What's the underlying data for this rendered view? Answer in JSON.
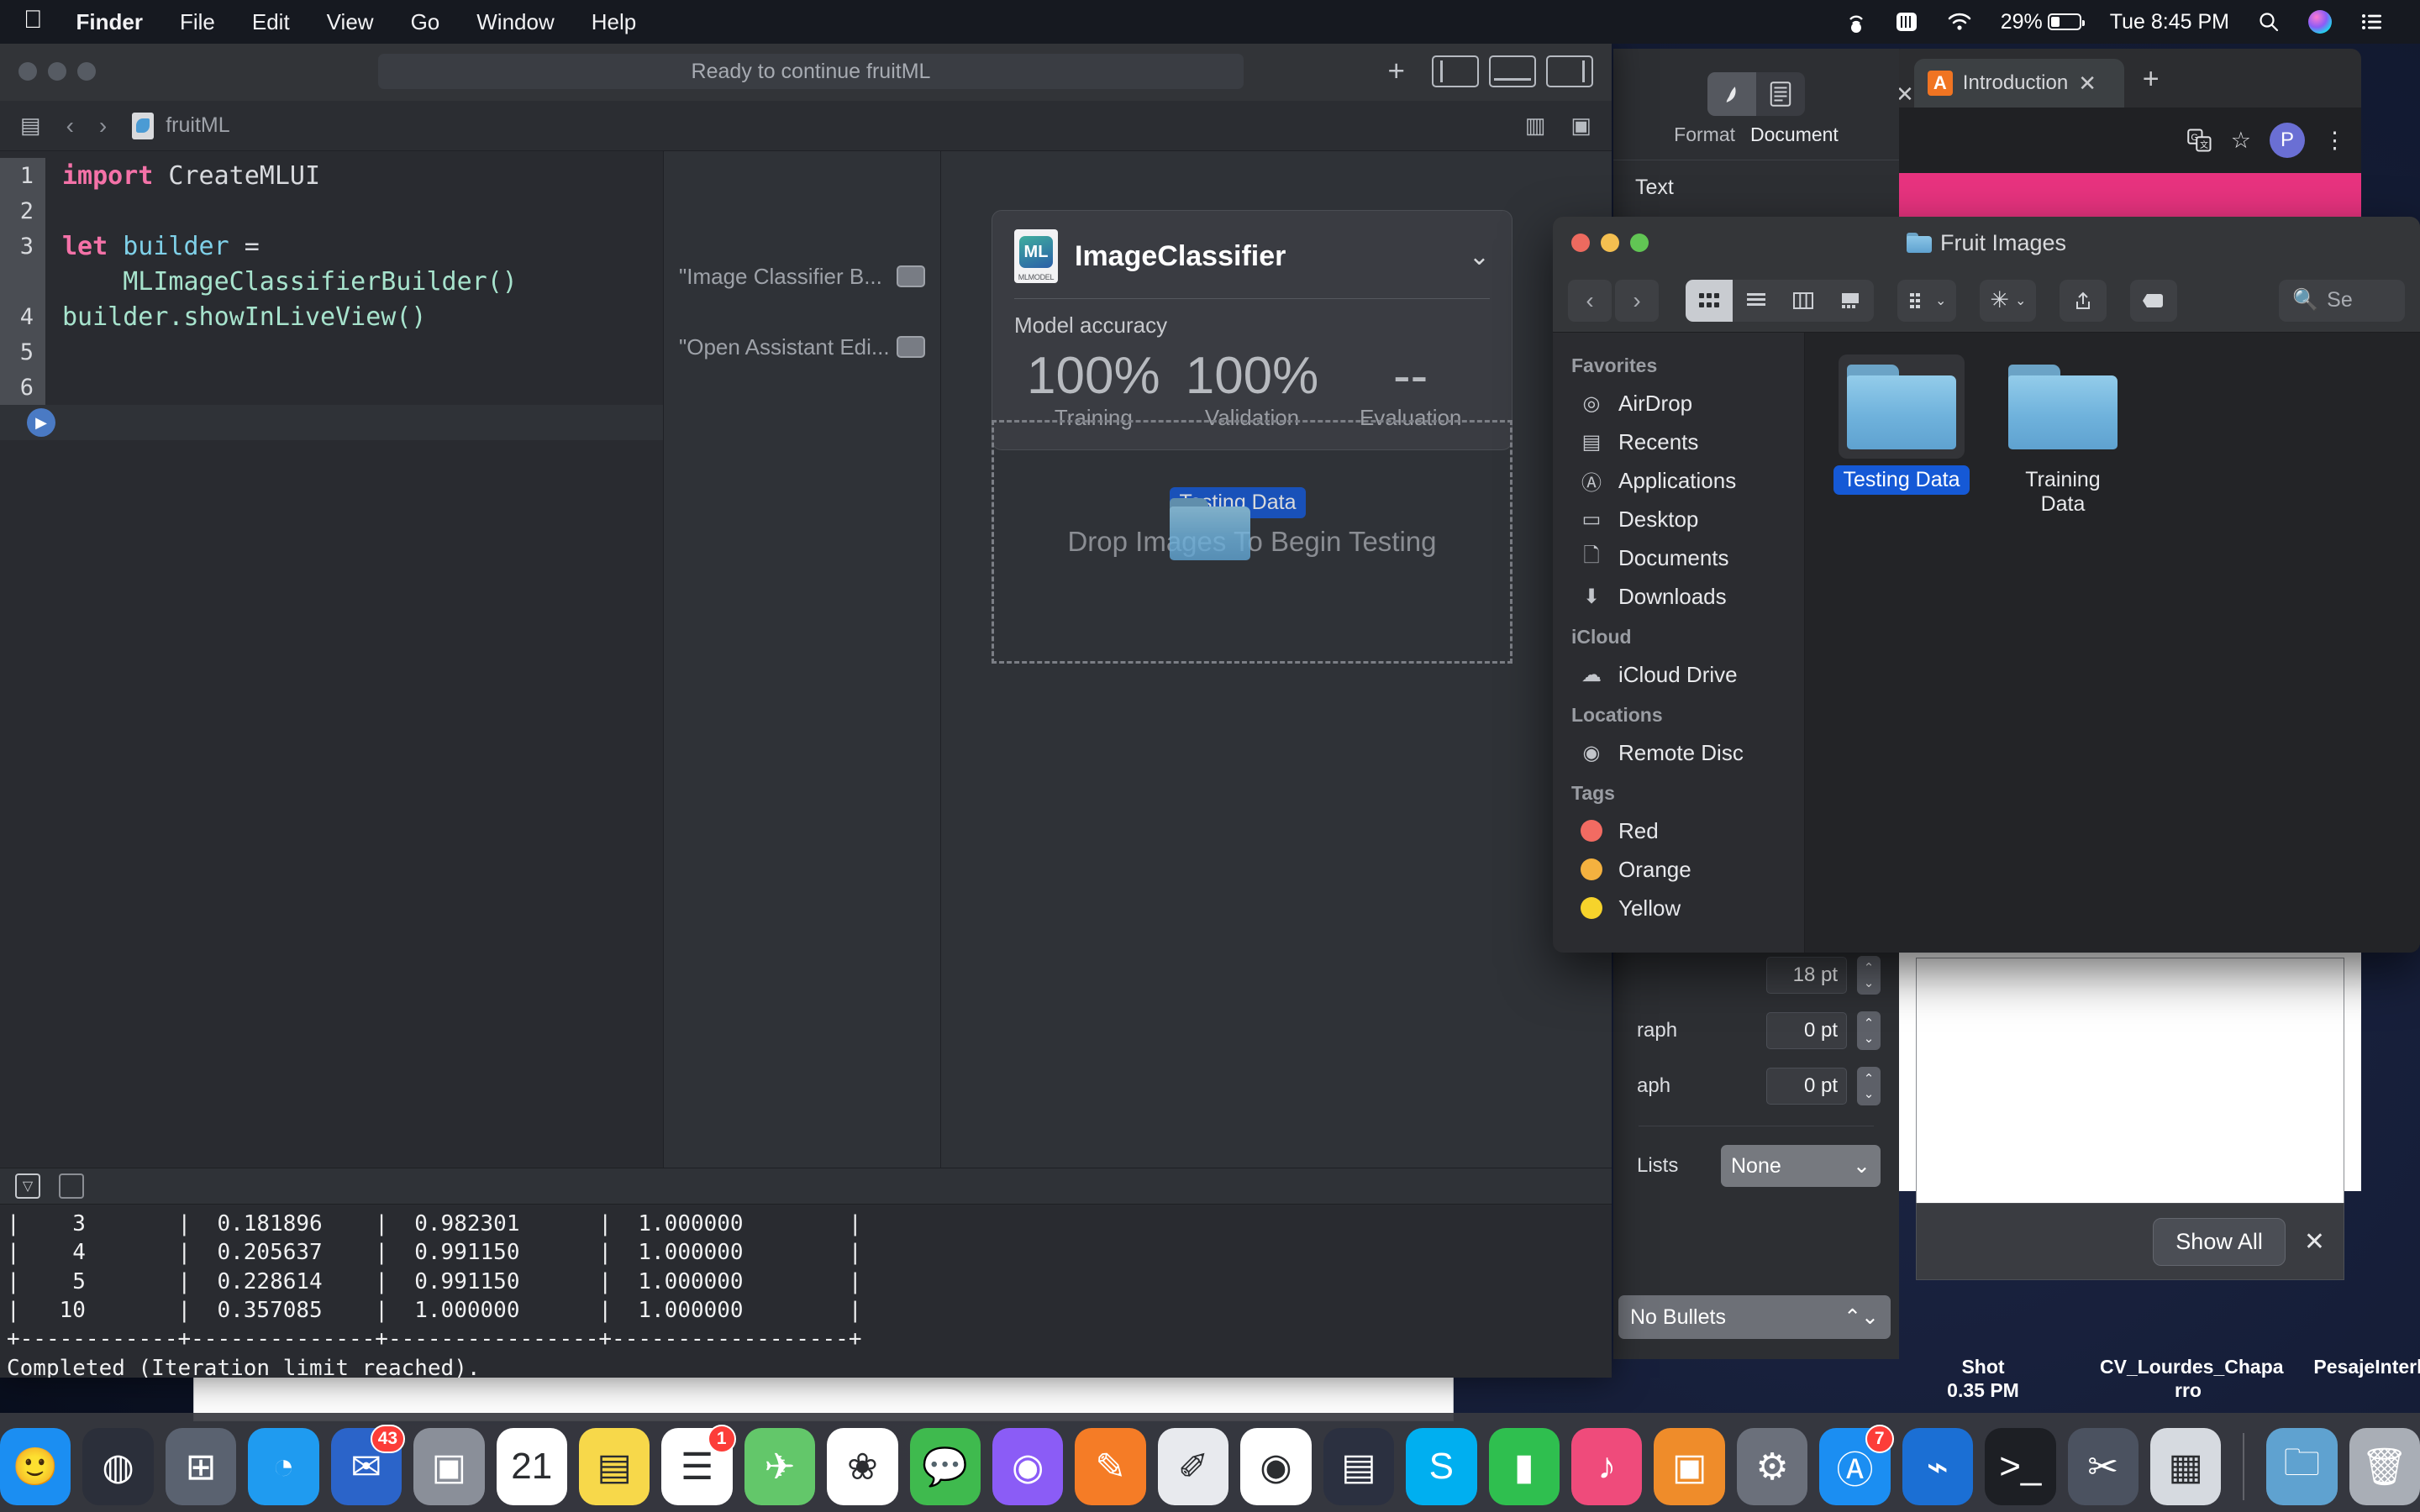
{
  "menubar": {
    "apple_logo": "apple-logo",
    "items": [
      "Finder",
      "File",
      "Edit",
      "View",
      "Go",
      "Window",
      "Help"
    ],
    "status": {
      "hotspot_icon": "personal-hotspot-icon",
      "display_icon": "display-brightness-icon",
      "wifi_icon": "wifi-icon",
      "battery_percent": "29%",
      "battery_level": 29,
      "clock": "Tue 8:45 PM",
      "search_icon": "spotlight-search-icon",
      "siri_icon": "siri-icon",
      "control_center_icon": "control-center-icon"
    }
  },
  "xcode": {
    "status_text": "Ready to continue fruitML",
    "add_label": "+",
    "breadcrumb": "fruitML",
    "file_icon": "swift-file-icon",
    "back_icon": "chevron-left-icon",
    "forward_icon": "chevron-right-icon",
    "related_items_icon": "related-items-icon",
    "editor": {
      "lines": [
        {
          "n": "1",
          "tokens": [
            {
              "t": "import",
              "c": "k-key"
            },
            {
              "t": " CreateMLUI",
              "c": "k-plain"
            }
          ]
        },
        {
          "n": "2",
          "tokens": []
        },
        {
          "n": "3",
          "tokens": [
            {
              "t": "let",
              "c": "k-key"
            },
            {
              "t": " builder ",
              "c": "k-var"
            },
            {
              "t": "=",
              "c": "k-plain"
            }
          ]
        },
        {
          "n": "",
          "tokens": [
            {
              "t": "    MLImageClassifierBuilder()",
              "c": "k-type"
            }
          ]
        },
        {
          "n": "4",
          "tokens": [
            {
              "t": "builder.showInLiveView()",
              "c": "k-type"
            }
          ]
        },
        {
          "n": "5",
          "tokens": []
        },
        {
          "n": "6",
          "tokens": []
        }
      ],
      "run_button": "run-playground-button"
    },
    "results": [
      {
        "text": "\"Image Classifier B...",
        "quicklook": "quick-look-button"
      },
      {
        "text": "\"Open Assistant Edi...",
        "quicklook": "quick-look-button"
      }
    ],
    "liveview": {
      "model_name": "ImageClassifier",
      "model_icon": "mlmodel-file-icon",
      "model_icon_caption": "MLMODEL",
      "model_icon_badge": "ML",
      "disclosure_icon": "chevron-down-icon",
      "accuracy_label": "Model accuracy",
      "stats": [
        {
          "value": "100%",
          "label": "Training"
        },
        {
          "value": "100%",
          "label": "Validation"
        },
        {
          "value": "--",
          "label": "Evaluation"
        }
      ],
      "dropzone_text": "Drop Images To Begin Testing",
      "drag_item": {
        "label": "Testing Data",
        "icon": "folder-icon"
      }
    },
    "console": {
      "filter_icon": "console-filter-button",
      "clear_icon": "console-clear-button",
      "output": "|    3       |  0.181896    |  0.982301      |  1.000000        |\n|    4       |  0.205637    |  0.991150      |  1.000000        |\n|    5       |  0.228614    |  0.991150      |  1.000000        |\n|   10       |  0.357085    |  1.000000      |  1.000000        |\n+------------+--------------+----------------+------------------+\nCompleted (Iteration limit reached)."
    }
  },
  "finder": {
    "title": "Fruit Images",
    "title_icon": "folder-icon",
    "back_icon": "chevron-left-icon",
    "forward_icon": "chevron-right-icon",
    "view_modes": [
      {
        "name": "icon-view",
        "glyph": "▦",
        "active": true
      },
      {
        "name": "list-view",
        "glyph": "☰",
        "active": false
      },
      {
        "name": "column-view",
        "glyph": "▥",
        "active": false
      },
      {
        "name": "gallery-view",
        "glyph": "▤",
        "active": false
      }
    ],
    "tools": [
      {
        "name": "arrange-button",
        "glyph": "▤",
        "caret": "⌄"
      },
      {
        "name": "action-gear-button",
        "glyph": "✲",
        "caret": "⌄"
      },
      {
        "name": "share-button",
        "glyph": "↥",
        "caret": ""
      },
      {
        "name": "tags-button",
        "glyph": "◖",
        "caret": ""
      }
    ],
    "search_placeholder": "Se",
    "search_icon": "search-icon",
    "sidebar": [
      {
        "group": "Favorites",
        "items": [
          {
            "label": "AirDrop",
            "icon": "airdrop-icon",
            "glyph": "◎"
          },
          {
            "label": "Recents",
            "icon": "recents-icon",
            "glyph": "▤"
          },
          {
            "label": "Applications",
            "icon": "applications-icon",
            "glyph": "Ⓐ"
          },
          {
            "label": "Desktop",
            "icon": "desktop-icon",
            "glyph": "▭"
          },
          {
            "label": "Documents",
            "icon": "documents-icon",
            "glyph": "🗋"
          },
          {
            "label": "Downloads",
            "icon": "downloads-icon",
            "glyph": "⬇"
          }
        ]
      },
      {
        "group": "iCloud",
        "items": [
          {
            "label": "iCloud Drive",
            "icon": "icloud-icon",
            "glyph": "☁"
          }
        ]
      },
      {
        "group": "Locations",
        "items": [
          {
            "label": "Remote Disc",
            "icon": "remote-disc-icon",
            "glyph": "◉"
          }
        ]
      },
      {
        "group": "Tags",
        "items": [
          {
            "label": "Red",
            "icon": "tag-dot",
            "color": "#f26b62"
          },
          {
            "label": "Orange",
            "icon": "tag-dot",
            "color": "#f4b13f"
          },
          {
            "label": "Yellow",
            "icon": "tag-dot",
            "color": "#f6d32b"
          }
        ]
      }
    ],
    "files": [
      {
        "name": "Testing Data",
        "icon": "folder-icon",
        "selected": true
      },
      {
        "name": "Training Data",
        "icon": "folder-icon",
        "selected": false
      }
    ]
  },
  "chrome": {
    "tab_title": "Introduction",
    "favicon_letter": "A",
    "tab_close_icon": "close-icon",
    "prev_tab_close_icon": "close-icon",
    "new_tab_icon": "new-tab-icon",
    "translate_icon": "translate-icon",
    "bookmark_icon": "bookmark-star-icon",
    "profile_initial": "P",
    "menu_icon": "three-dot-menu-icon"
  },
  "pages": {
    "tabs": [
      {
        "label": "Format",
        "icon": "format-brush-icon",
        "active": true
      },
      {
        "label": "Document",
        "icon": "document-icon",
        "active": false
      }
    ],
    "section": "Text",
    "rows": [
      {
        "label": "",
        "value": "18 pt",
        "stepper": "spacing-stepper"
      },
      {
        "label": "raph",
        "value": "0 pt",
        "stepper": "before-paragraph-stepper"
      },
      {
        "label": "aph",
        "value": "0 pt",
        "stepper": "after-paragraph-stepper"
      }
    ],
    "lists_label": "Lists",
    "lists_value": "None",
    "bullets_value": "No Bullets"
  },
  "screenshot_toast": {
    "show_all_label": "Show All",
    "close_icon": "close-icon"
  },
  "desktop_files": [
    {
      "line1": "Shot",
      "line2": "0.35 PM"
    },
    {
      "line1": "CV_Lourdes_Chapa",
      "line2": "rro"
    },
    {
      "line1": "PesajeInterlomas",
      "line2": ""
    }
  ],
  "dock": [
    {
      "name": "finder",
      "glyph": "🙂",
      "color": "#1b8ef2",
      "badge": ""
    },
    {
      "name": "siri",
      "glyph": "◍",
      "color": "#2b2f3a",
      "badge": ""
    },
    {
      "name": "launchpad",
      "glyph": "⊞",
      "color": "#5a6270",
      "badge": ""
    },
    {
      "name": "safari",
      "glyph": "◔",
      "color": "#1f9bf0",
      "badge": ""
    },
    {
      "name": "mail",
      "glyph": "✉",
      "color": "#2b64c9",
      "badge": "43"
    },
    {
      "name": "contacts",
      "glyph": "▣",
      "color": "#8a8f99",
      "badge": ""
    },
    {
      "name": "calendar",
      "glyph": "21",
      "color": "#ffffff",
      "badge": ""
    },
    {
      "name": "notes",
      "glyph": "▤",
      "color": "#f7d84a",
      "badge": ""
    },
    {
      "name": "reminders",
      "glyph": "☰",
      "color": "#ffffff",
      "badge": "1"
    },
    {
      "name": "maps",
      "glyph": "✈",
      "color": "#63c76a",
      "badge": ""
    },
    {
      "name": "photos",
      "glyph": "❀",
      "color": "#ffffff",
      "badge": ""
    },
    {
      "name": "messages",
      "glyph": "💬",
      "color": "#3fba4e",
      "badge": ""
    },
    {
      "name": "podcasts",
      "glyph": "◉",
      "color": "#8b5cf6",
      "badge": ""
    },
    {
      "name": "pages",
      "glyph": "✎",
      "color": "#f57c26",
      "badge": ""
    },
    {
      "name": "textedit",
      "glyph": "✐",
      "color": "#e8eaee",
      "badge": ""
    },
    {
      "name": "chrome",
      "glyph": "◉",
      "color": "#ffffff",
      "badge": ""
    },
    {
      "name": "keynote",
      "glyph": "▤",
      "color": "#2b3040",
      "badge": ""
    },
    {
      "name": "skype",
      "glyph": "S",
      "color": "#00aff0",
      "badge": ""
    },
    {
      "name": "numbers",
      "glyph": "▮",
      "color": "#2fbf4f",
      "badge": ""
    },
    {
      "name": "itunes",
      "glyph": "♪",
      "color": "#ef4b7b",
      "badge": ""
    },
    {
      "name": "books",
      "glyph": "▣",
      "color": "#ef8c2a",
      "badge": ""
    },
    {
      "name": "system-preferences",
      "glyph": "⚙",
      "color": "#6b707b",
      "badge": ""
    },
    {
      "name": "app-store",
      "glyph": "Ⓐ",
      "color": "#1b8ef2",
      "badge": "7"
    },
    {
      "name": "xcode",
      "glyph": "⌁",
      "color": "#1b6fd4",
      "badge": ""
    },
    {
      "name": "terminal",
      "glyph": "&gt;_",
      "color": "#1d1f24",
      "badge": ""
    },
    {
      "name": "utilities",
      "glyph": "✂",
      "color": "#4b5260",
      "badge": ""
    },
    {
      "name": "preview",
      "glyph": "▦",
      "color": "#d6dae0",
      "badge": ""
    },
    {
      "name": "downloads-stack",
      "glyph": "🗀",
      "color": "#5fa2d0",
      "badge": ""
    },
    {
      "name": "trash",
      "glyph": "🗑",
      "color": "#a9aeb6",
      "badge": ""
    }
  ]
}
